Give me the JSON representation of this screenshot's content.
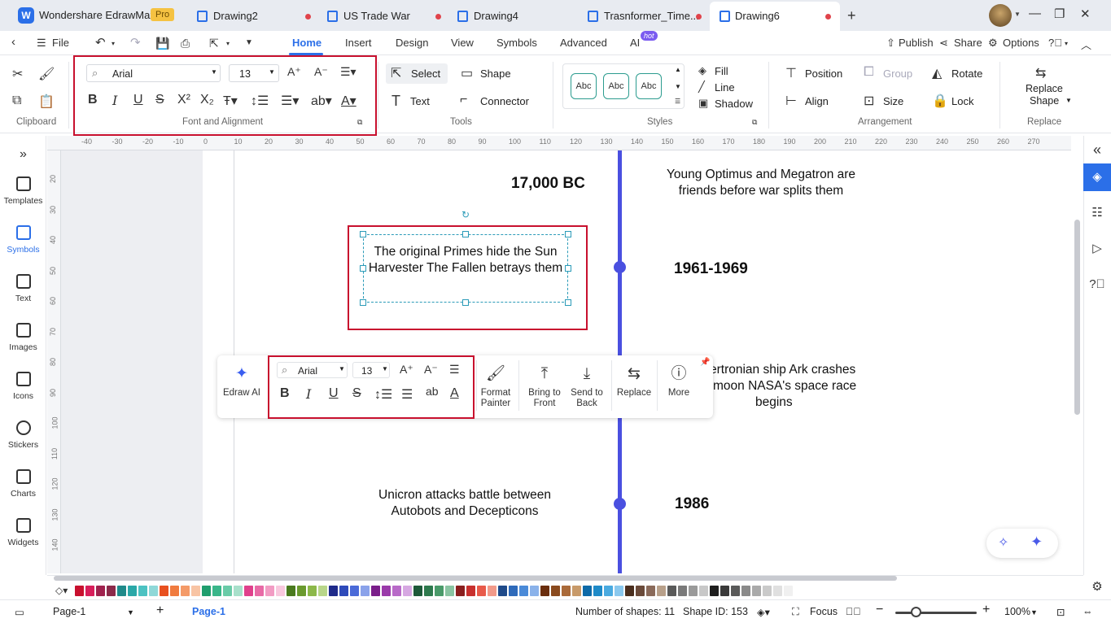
{
  "app": {
    "logo_glyph": "W",
    "name": "Wondershare EdrawMax",
    "badge": "Pro"
  },
  "tabs": [
    {
      "label": "Drawing2",
      "modified": true
    },
    {
      "label": "US Trade War",
      "modified": true
    },
    {
      "label": "Drawing4",
      "modified": false
    },
    {
      "label": "Trasnformer_Time...",
      "modified": true
    },
    {
      "label": "Drawing6",
      "modified": true,
      "active": true
    }
  ],
  "menu": {
    "file": "File",
    "items": [
      "Home",
      "Insert",
      "Design",
      "View",
      "Symbols",
      "Advanced",
      "AI"
    ],
    "active": "Home",
    "ai_badge": "hot",
    "publish": "Publish",
    "share": "Share",
    "options": "Options"
  },
  "ribbon": {
    "clipboard_label": "Clipboard",
    "font_label": "Font and Alignment",
    "font_family": "Arial",
    "font_size": "13",
    "tools_label": "Tools",
    "select": "Select",
    "shape": "Shape",
    "text": "Text",
    "connector": "Connector",
    "styles_label": "Styles",
    "style_sample": "Abc",
    "fill": "Fill",
    "line": "Line",
    "shadow": "Shadow",
    "position": "Position",
    "group": "Group",
    "rotate": "Rotate",
    "align": "Align",
    "size": "Size",
    "lock": "Lock",
    "arrangement_label": "Arrangement",
    "replace_shape_1": "Replace",
    "replace_shape_2": "Shape",
    "replace_label": "Replace"
  },
  "ruler": {
    "top": [
      "-40",
      "-30",
      "-20",
      "-10",
      "0",
      "10",
      "20",
      "30",
      "40",
      "50",
      "60",
      "70",
      "80",
      "90",
      "100",
      "110",
      "120",
      "130",
      "140",
      "150",
      "160",
      "170",
      "180",
      "190",
      "200",
      "210",
      "220",
      "230",
      "240",
      "250",
      "260",
      "270"
    ],
    "left": [
      "20",
      "30",
      "40",
      "50",
      "60",
      "70",
      "80",
      "90",
      "100",
      "110",
      "120",
      "130",
      "140"
    ]
  },
  "left_panel": [
    {
      "label": "Templates"
    },
    {
      "label": "Symbols",
      "active": true
    },
    {
      "label": "Text"
    },
    {
      "label": "Images"
    },
    {
      "label": "Icons"
    },
    {
      "label": "Stickers"
    },
    {
      "label": "Charts"
    },
    {
      "label": "Widgets"
    }
  ],
  "canvas": {
    "date1": "17,000 BC",
    "event1": "Young Optimus and Megatron are friends before war splits them",
    "event2": "The original Primes hide the Sun Harvester The Fallen betrays them",
    "date2": "1961-1969",
    "event3_line1": "ertronian ship Ark crashes",
    "event3_line2": "moon NASA's space race",
    "event3_line3": "begins",
    "event4": "Unicron attacks battle between Autobots and Decepticons",
    "date3": "1986"
  },
  "floating_toolbar": {
    "ai": "Edraw AI",
    "font_family": "Arial",
    "font_size": "13",
    "format_painter_1": "Format",
    "format_painter_2": "Painter",
    "bring_front_1": "Bring to",
    "bring_front_2": "Front",
    "send_back_1": "Send to",
    "send_back_2": "Back",
    "replace": "Replace",
    "more": "More"
  },
  "palette": [
    "#c8102e",
    "#d81e5b",
    "#a0224e",
    "#8c2a4a",
    "#1f8a8a",
    "#2aa8a8",
    "#4cc2c2",
    "#8fd8d8",
    "#e8501f",
    "#f07b3f",
    "#f49a68",
    "#f8c4a4",
    "#1f9e6e",
    "#3ab68a",
    "#6acba8",
    "#a8e0cb",
    "#e0408c",
    "#e86aa6",
    "#f29cc4",
    "#f8c8de",
    "#4a7a1e",
    "#6a9a2e",
    "#8cb84a",
    "#b8d68a",
    "#1e2a8a",
    "#2e4aba",
    "#4a6ad8",
    "#8aa2ea",
    "#7a1e8a",
    "#9a3aaa",
    "#b86ac8",
    "#d6a8e2",
    "#1e5a3a",
    "#2e7a4e",
    "#4a9a6a",
    "#8ac4a2",
    "#8a1e1e",
    "#c8302e",
    "#e85a4a",
    "#f29a8a",
    "#1e4a8a",
    "#2e6aba",
    "#4a8ad8",
    "#8ab2ea",
    "#6a2e0e",
    "#8a4a1e",
    "#aa6a3a",
    "#c89a6a",
    "#0e6aa8",
    "#1e8ac8",
    "#4aaae0",
    "#8ac8ee",
    "#4a2e1e",
    "#6a4a3a",
    "#8a6a5a",
    "#b8a08a",
    "#5a5a5a",
    "#7a7a7a",
    "#9a9a9a",
    "#c8c8c8",
    "#1e1e1e",
    "#3a3a3a",
    "#5a5a5a",
    "#8a8a8a",
    "#aaaaaa",
    "#cacaca",
    "#e0e0e0",
    "#f0f0f0"
  ],
  "status": {
    "page_tab": "Page-1",
    "active_page": "Page-1",
    "shape_count": "Number of shapes: 11",
    "shape_id": "Shape ID: 153",
    "focus": "Focus",
    "zoom": "100%"
  }
}
